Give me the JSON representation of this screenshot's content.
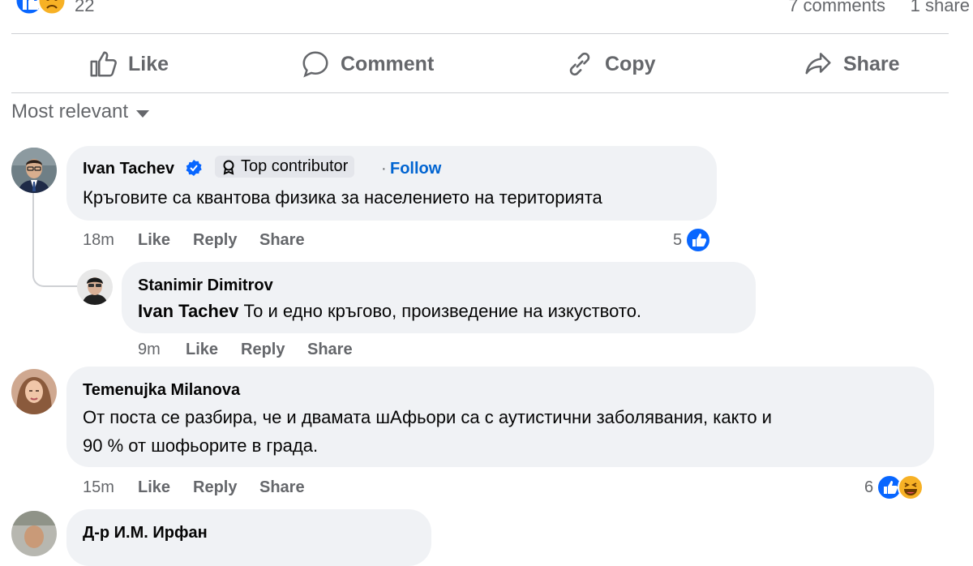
{
  "post_stats": {
    "reaction_count": "22",
    "comments": "7 comments",
    "shares": "1 share"
  },
  "actions": {
    "like": "Like",
    "comment": "Comment",
    "copy": "Copy",
    "share": "Share"
  },
  "sort": {
    "label": "Most relevant"
  },
  "comments": [
    {
      "author": "Ivan Tachev",
      "badge": "Top contributor",
      "follow": "Follow",
      "text": "Кръговите са квантова физика за населението на територията",
      "time": "18m",
      "like": "Like",
      "reply": "Reply",
      "share": "Share",
      "reactions": "5",
      "replies": [
        {
          "author": "Stanimir Dimitrov",
          "mention": "Ivan Tachev",
          "text": "То и едно кръгово, произведение на изкуството.",
          "time": "9m",
          "like": "Like",
          "reply": "Reply",
          "share": "Share"
        }
      ]
    },
    {
      "author": "Temenujka Milanova",
      "text_line1": "От поста се разбира, че и двамата шАфьори са с аутистични заболявания, както и",
      "text_line2": "90 % от шофьорите в града.",
      "time": "15m",
      "like": "Like",
      "reply": "Reply",
      "share": "Share",
      "reactions": "6"
    },
    {
      "author": "Д-р И.М. Ирфан"
    }
  ],
  "colors": {
    "like_blue": "#0866ff",
    "bubble_bg": "#f0f2f5",
    "secondary_text": "#65676b",
    "link_blue": "#0064d1"
  },
  "icons": [
    "like-reaction-icon",
    "care-reaction-icon",
    "thumbs-up-icon",
    "comment-icon",
    "link-icon",
    "share-icon",
    "verified-icon",
    "top-contributor-icon",
    "haha-reaction-icon"
  ]
}
